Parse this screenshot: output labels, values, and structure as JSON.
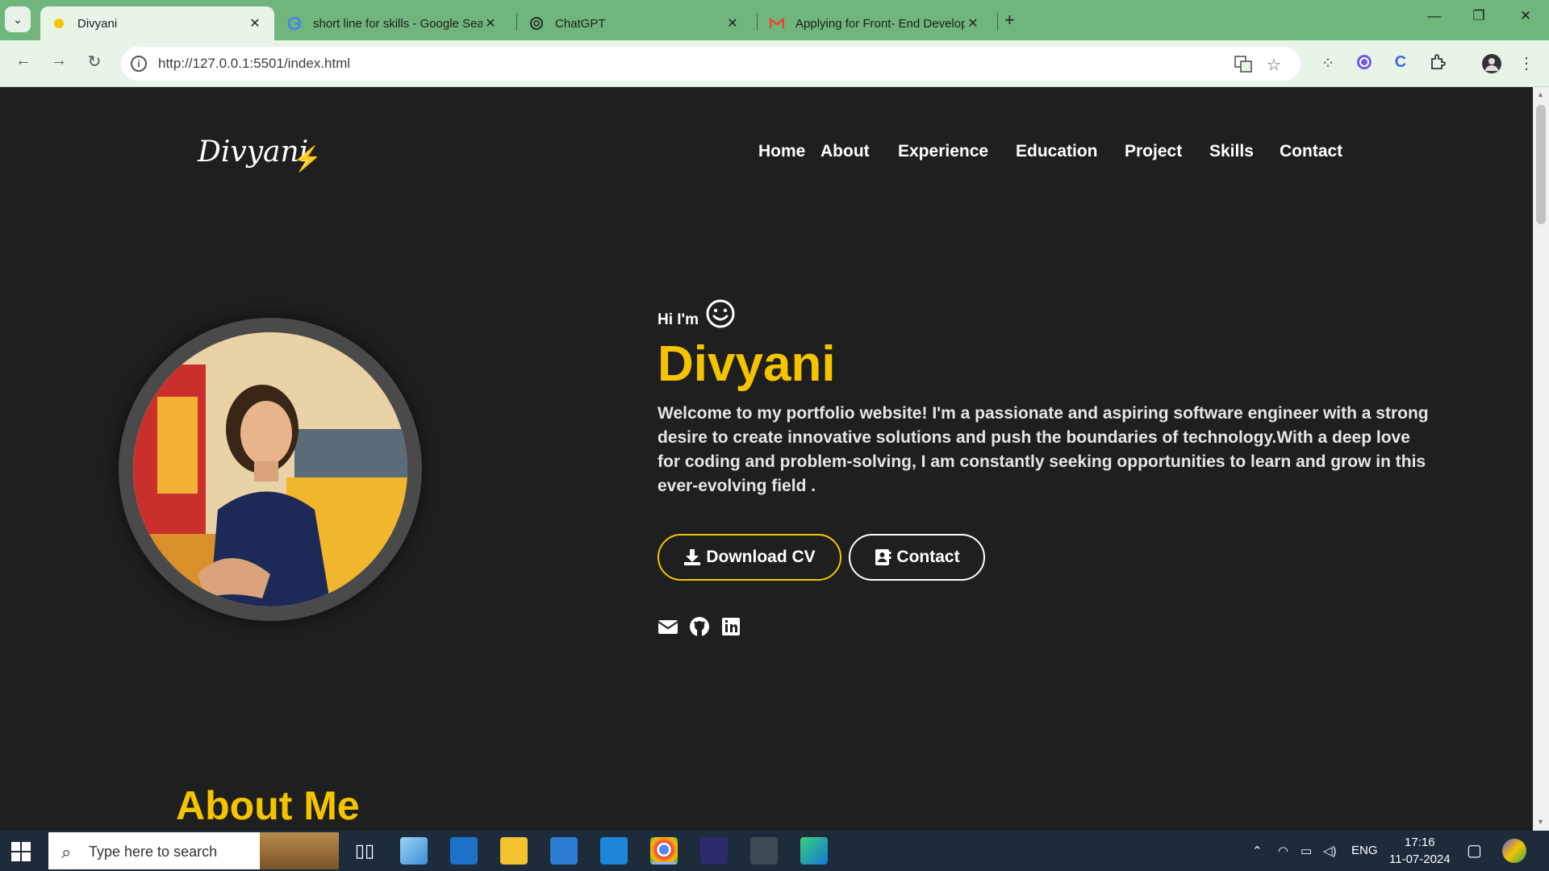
{
  "browser": {
    "tabs": [
      {
        "title": "Divyani",
        "active": true
      },
      {
        "title": "short line for skills - Google Sea",
        "active": false
      },
      {
        "title": "ChatGPT",
        "active": false
      },
      {
        "title": "Applying for Front- End Develop",
        "active": false
      }
    ],
    "url": "http://127.0.0.1:5501/index.html"
  },
  "site": {
    "logo_text": "Divyani",
    "nav": [
      "Home",
      "About",
      "Experience",
      "Education",
      "Project",
      "Skills",
      "Contact"
    ],
    "greeting": "Hi I'm",
    "name": "Divyani",
    "intro": "Welcome to my portfolio website! I'm a passionate and aspiring software engineer with a strong desire to create innovative solutions and push the boundaries of technology.With a deep love for coding and problem-solving, I am constantly seeking opportunities to learn and grow in this ever-evolving field .",
    "download_cv_label": "Download CV",
    "contact_label": "Contact",
    "about_heading": "About Me"
  },
  "taskbar": {
    "search_placeholder": "Type here to search",
    "language": "ENG",
    "time": "17:16",
    "date": "11-07-2024"
  },
  "colors": {
    "accent": "#f4c400",
    "page_bg": "#1f1f1f",
    "chrome_tabbar": "#6fb57c"
  }
}
